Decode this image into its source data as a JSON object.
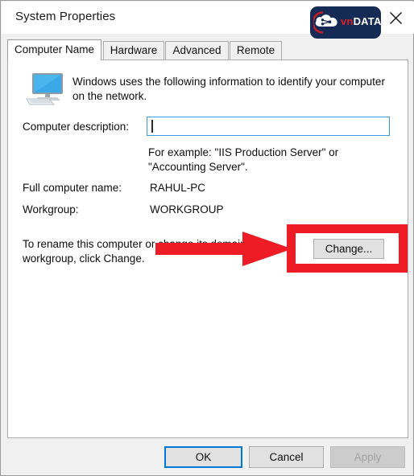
{
  "window": {
    "title": "System Properties",
    "close_icon": "close-icon"
  },
  "branding": {
    "logo_prefix": "vn",
    "logo_suffix": "DATA",
    "logo_bg_color": "#152b55",
    "logo_accent_color": "#d72027"
  },
  "tabs": [
    {
      "label": "Computer Name",
      "active": true
    },
    {
      "label": "Hardware",
      "active": false
    },
    {
      "label": "Advanced",
      "active": false
    },
    {
      "label": "Remote",
      "active": false
    }
  ],
  "panel": {
    "intro": "Windows uses the following information to identify your computer on the network.",
    "computer_description_label": "Computer description:",
    "computer_description_value": "",
    "computer_description_placeholder": "",
    "example_text": "For example: \"IIS Production Server\" or \"Accounting Server\".",
    "full_computer_name_label": "Full computer name:",
    "full_computer_name_value": "RAHUL-PC",
    "workgroup_label": "Workgroup:",
    "workgroup_value": "WORKGROUP",
    "rename_text": "To rename this computer or change its domain or workgroup, click Change.",
    "change_button": "Change..."
  },
  "footer": {
    "ok_label": "OK",
    "cancel_label": "Cancel",
    "apply_label": "Apply",
    "apply_enabled": false
  },
  "annotations": {
    "highlight_color": "#ee1c25",
    "target": "Change..."
  }
}
